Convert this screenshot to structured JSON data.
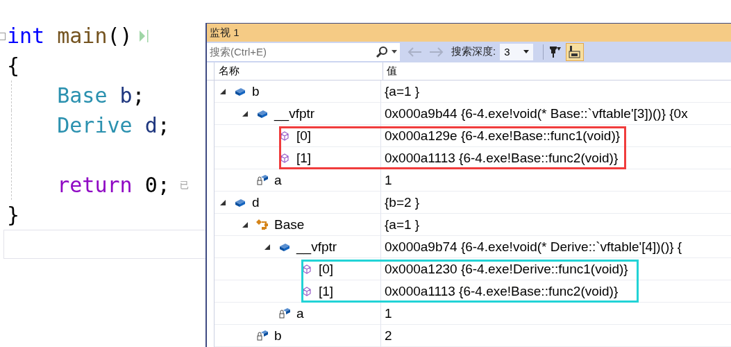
{
  "editor": {
    "lines": [
      {
        "fold": true,
        "run_marker": true,
        "tokens": [
          {
            "text": "int",
            "kind": "keyword"
          },
          {
            "text": " main",
            "kind": "function"
          },
          {
            "text": "()",
            "kind": "plain"
          }
        ]
      },
      {
        "tokens": [
          {
            "text": "{",
            "kind": "plain"
          }
        ],
        "children": [
          {
            "tokens": [
              {
                "text": "Base",
                "kind": "type"
              },
              {
                "text": " b",
                "kind": "variable"
              },
              {
                "text": ";",
                "kind": "plain"
              }
            ]
          },
          {
            "tokens": [
              {
                "text": "Derive",
                "kind": "type"
              },
              {
                "text": " d",
                "kind": "variable"
              },
              {
                "text": ";",
                "kind": "plain"
              }
            ]
          },
          {
            "space_before": true,
            "tokens": [
              {
                "text": "return",
                "kind": "control"
              },
              {
                "text": " 0",
                "kind": "plain"
              },
              {
                "text": ";",
                "kind": "plain"
              }
            ],
            "hint": "已"
          }
        ]
      },
      {
        "tokens": [
          {
            "text": "}",
            "kind": "plain"
          }
        ]
      }
    ]
  },
  "watch": {
    "title": "监视 1",
    "search": {
      "placeholder": "搜索(Ctrl+E)"
    },
    "back_disabled": true,
    "forward_disabled": true,
    "depth_label": "搜索深度:",
    "depth_value": "3",
    "hex_toggle": {
      "selected": true
    },
    "columns": [
      "名称",
      "值"
    ],
    "rows": [
      {
        "name": "b",
        "value": "{a=1 }",
        "kind": "object",
        "expanded": true,
        "children": [
          {
            "name": "__vfptr",
            "value": "0x000a9b44 {6-4.exe!void(* Base::`vftable'[3])()} {0x",
            "kind": "object",
            "expanded": true,
            "color": "#f03c3c",
            "children": [
              {
                "name": "[0]",
                "value": "0x000a129e {6-4.exe!Base::func1(void)}",
                "kind": "entry"
              },
              {
                "name": "[1]",
                "value": "0x000a1113 {6-4.exe!Base::func2(void)}",
                "kind": "entry"
              }
            ]
          },
          {
            "name": "a",
            "value": "1",
            "kind": "private"
          }
        ]
      },
      {
        "name": "d",
        "value": "{b=2 }",
        "kind": "object",
        "expanded": true,
        "children": [
          {
            "name": "Base",
            "value": "{a=1 }",
            "kind": "base",
            "expanded": true,
            "children": [
              {
                "name": "__vfptr",
                "value": "0x000a9b74 {6-4.exe!void(* Derive::`vftable'[4])()} {",
                "kind": "object",
                "expanded": true,
                "color": "#22d3d6",
                "children": [
                  {
                    "name": "[0]",
                    "value": "0x000a1230 {6-4.exe!Derive::func1(void)}",
                    "kind": "entry"
                  },
                  {
                    "name": "[1]",
                    "value": "0x000a1113 {6-4.exe!Base::func2(void)}",
                    "kind": "entry"
                  }
                ]
              },
              {
                "name": "a",
                "value": "1",
                "kind": "private"
              }
            ]
          },
          {
            "name": "b",
            "value": "2",
            "kind": "private"
          }
        ]
      }
    ]
  }
}
